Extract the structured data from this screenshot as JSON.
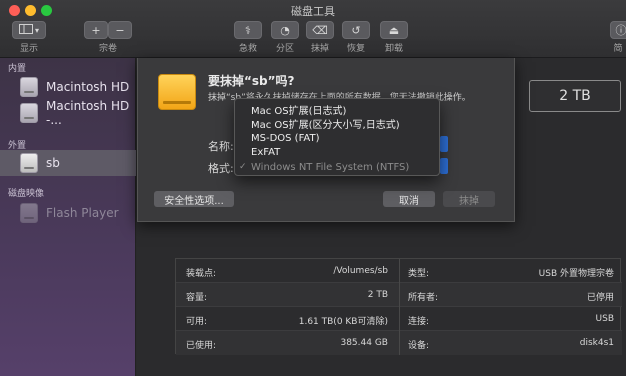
{
  "window": {
    "title": "磁盘工具"
  },
  "toolbar": {
    "display_label": "显示",
    "volume_label": "宗卷",
    "plus_symbol": "+",
    "minus_symbol": "−",
    "buttons": [
      {
        "label": "急救"
      },
      {
        "label": "分区"
      },
      {
        "label": "抹掉"
      },
      {
        "label": "恢复"
      },
      {
        "label": "卸载"
      }
    ],
    "right_label": "简"
  },
  "sidebar": {
    "internal_header": "内置",
    "external_header": "外置",
    "images_header": "磁盘映像",
    "items": [
      {
        "label": "Macintosh HD"
      },
      {
        "label": "Macintosh HD -..."
      },
      {
        "label": "sb"
      },
      {
        "label": "Flash Player"
      }
    ]
  },
  "main": {
    "capacity_display": "2 TB"
  },
  "sheet": {
    "title": "要抹掉“sb”吗?",
    "message": "抹掉“sb”将永久抹掉储存在上面的所有数据。您无法撤销此操作。",
    "name_label": "名称:",
    "format_label": "格式:",
    "security_button": "安全性选项...",
    "cancel_button": "取消",
    "erase_button": "抹掉"
  },
  "format_menu": {
    "options": [
      {
        "label": "Mac OS扩展(日志式)"
      },
      {
        "label": "Mac OS扩展(区分大小写,日志式)"
      },
      {
        "label": "MS-DOS (FAT)"
      },
      {
        "label": "ExFAT"
      },
      {
        "label": "Windows NT File System (NTFS)",
        "checked": true,
        "disabled": true
      }
    ],
    "check_glyph": "✓"
  },
  "info": {
    "rows": [
      {
        "l_label": "装载点:",
        "l_value": "/Volumes/sb",
        "r_label": "类型:",
        "r_value": "USB 外置物理宗卷"
      },
      {
        "l_label": "容量:",
        "l_value": "2 TB",
        "r_label": "所有者:",
        "r_value": "已停用"
      },
      {
        "l_label": "可用:",
        "l_value": "1.61 TB(0 KB可清除)",
        "r_label": "连接:",
        "r_value": "USB"
      },
      {
        "l_label": "已使用:",
        "l_value": "385.44 GB",
        "r_label": "设备:",
        "r_value": "disk4s1"
      }
    ]
  }
}
